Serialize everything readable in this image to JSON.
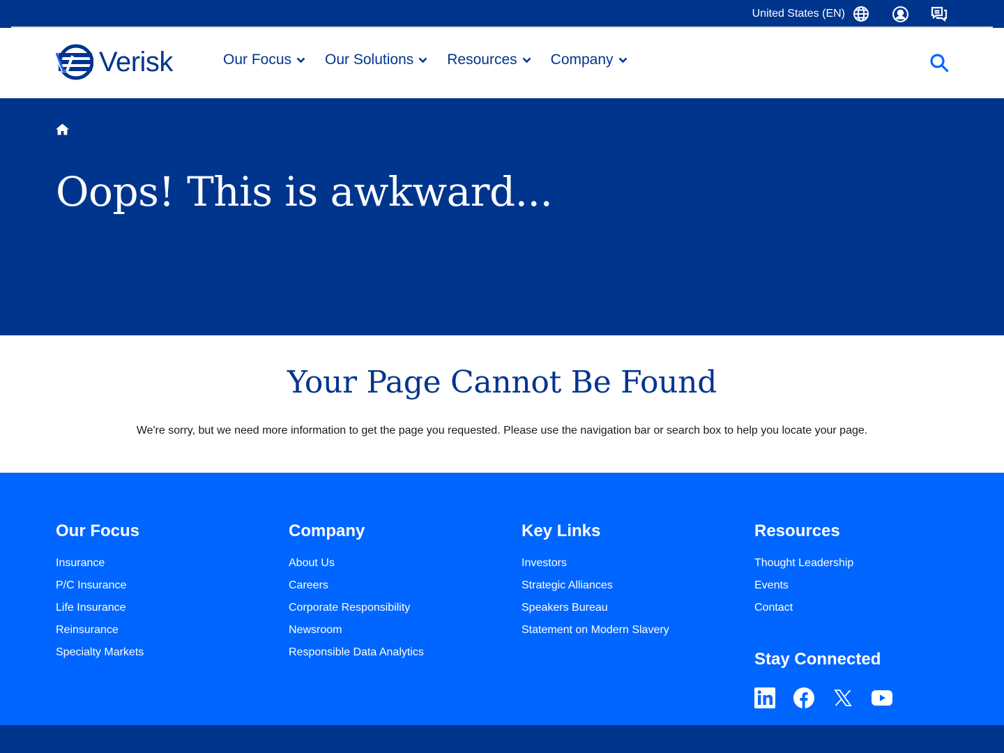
{
  "utility": {
    "region": "United States (EN)",
    "icons": [
      "globe-icon",
      "user-account-icon",
      "chat-support-icon"
    ]
  },
  "header": {
    "logo_text": "Verisk",
    "nav": [
      {
        "label": "Our Focus"
      },
      {
        "label": "Our Solutions"
      },
      {
        "label": "Resources"
      },
      {
        "label": "Company"
      }
    ],
    "search_icon": "search-icon"
  },
  "hero": {
    "home_icon": "home-icon",
    "title": "Oops! This is awkward..."
  },
  "message": {
    "heading": "Your Page Cannot Be Found",
    "body": "We're sorry, but we need more information to get the page you requested. Please use the navigation bar or search box to help you locate your page."
  },
  "footer": {
    "columns": [
      {
        "title": "Our Focus",
        "links": [
          "Insurance",
          "P/C Insurance",
          "Life Insurance",
          "Reinsurance",
          "Specialty Markets"
        ]
      },
      {
        "title": "Company",
        "links": [
          "About Us",
          "Careers",
          "Corporate Responsibility",
          "Newsroom",
          "Responsible Data Analytics"
        ]
      },
      {
        "title": "Key Links",
        "links": [
          "Investors",
          "Strategic Alliances",
          "Speakers Bureau",
          "Statement on Modern Slavery"
        ]
      },
      {
        "title": "Resources",
        "links": [
          "Thought Leadership",
          "Events",
          "Contact"
        ]
      }
    ],
    "stay_connected": "Stay Connected",
    "socials": [
      "linkedin-icon",
      "facebook-icon",
      "x-icon",
      "youtube-icon"
    ]
  },
  "colors": {
    "navy": "#00358e",
    "footer_blue": "#0066ff",
    "white": "#ffffff"
  }
}
